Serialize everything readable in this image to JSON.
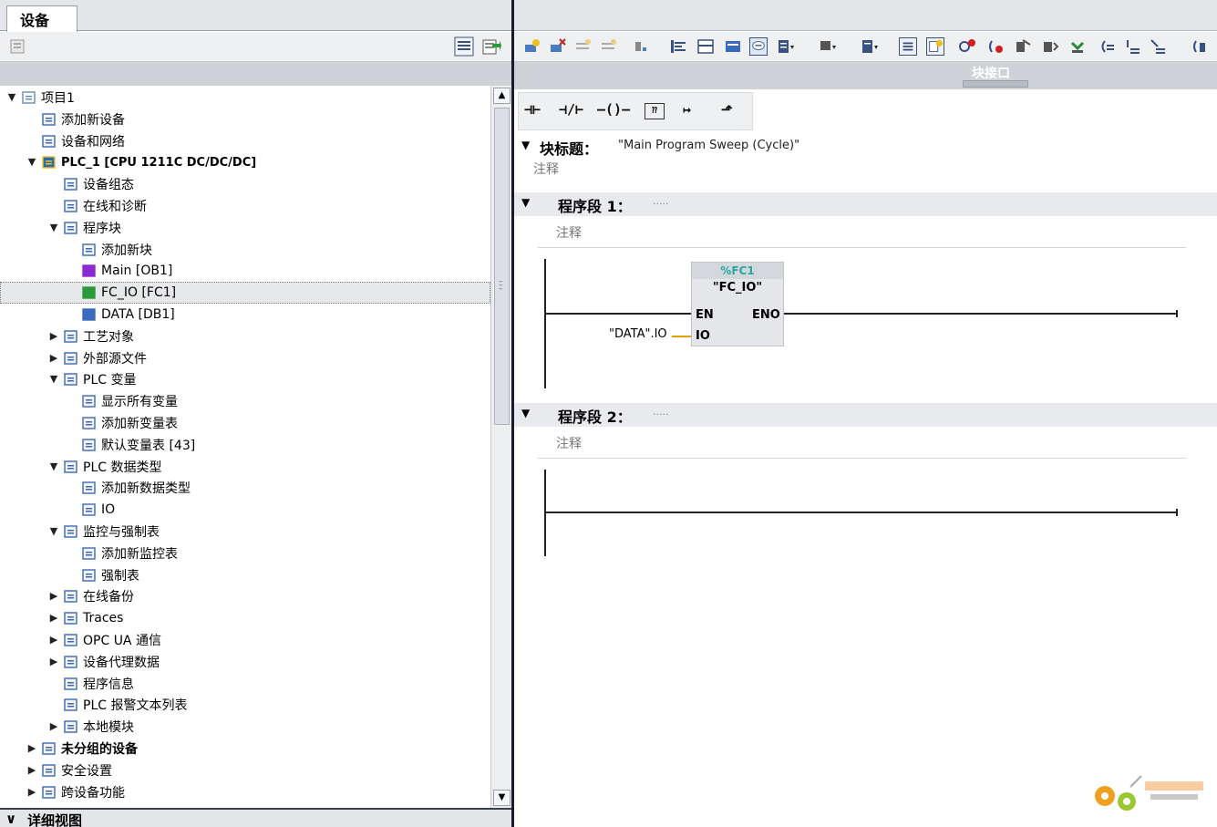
{
  "left_panel": {
    "tab": "设备",
    "tree": [
      {
        "label": "项目1",
        "arrow": "▼",
        "level": 0,
        "icon": "project-icon"
      },
      {
        "label": "添加新设备",
        "arrow": "",
        "level": 1,
        "icon": "add-device-icon"
      },
      {
        "label": "设备和网络",
        "arrow": "",
        "level": 1,
        "icon": "network-icon"
      },
      {
        "label": "PLC_1 [CPU 1211C DC/DC/DC]",
        "arrow": "▼",
        "level": 1,
        "icon": "plc-icon",
        "style": "plc"
      },
      {
        "label": "设备组态",
        "arrow": "",
        "level": 2,
        "icon": "device-config-icon"
      },
      {
        "label": "在线和诊断",
        "arrow": "",
        "level": 2,
        "icon": "online-diagnostics-icon"
      },
      {
        "label": "程序块",
        "arrow": "▼",
        "level": 2,
        "icon": "program-blocks-folder-icon"
      },
      {
        "label": "添加新块",
        "arrow": "",
        "level": 3,
        "icon": "add-block-icon"
      },
      {
        "label": "Main [OB1]",
        "arrow": "",
        "level": 3,
        "icon": "ob-block-icon"
      },
      {
        "label": "FC_IO [FC1]",
        "arrow": "",
        "level": 3,
        "icon": "fc-block-icon",
        "selected": true
      },
      {
        "label": "DATA [DB1]",
        "arrow": "",
        "level": 3,
        "icon": "db-block-icon"
      },
      {
        "label": "工艺对象",
        "arrow": "▶",
        "level": 2,
        "icon": "technology-objects-icon"
      },
      {
        "label": "外部源文件",
        "arrow": "▶",
        "level": 2,
        "icon": "external-source-icon"
      },
      {
        "label": "PLC 变量",
        "arrow": "▼",
        "level": 2,
        "icon": "plc-tags-folder-icon"
      },
      {
        "label": "显示所有变量",
        "arrow": "",
        "level": 3,
        "icon": "show-all-tags-icon"
      },
      {
        "label": "添加新变量表",
        "arrow": "",
        "level": 3,
        "icon": "add-tag-table-icon"
      },
      {
        "label": "默认变量表 [43]",
        "arrow": "",
        "level": 3,
        "icon": "default-tag-table-icon"
      },
      {
        "label": "PLC 数据类型",
        "arrow": "▼",
        "level": 2,
        "icon": "plc-datatypes-folder-icon"
      },
      {
        "label": "添加新数据类型",
        "arrow": "",
        "level": 3,
        "icon": "add-datatype-icon"
      },
      {
        "label": "IO",
        "arrow": "",
        "level": 3,
        "icon": "udt-icon"
      },
      {
        "label": "监控与强制表",
        "arrow": "▼",
        "level": 2,
        "icon": "watch-force-folder-icon"
      },
      {
        "label": "添加新监控表",
        "arrow": "",
        "level": 3,
        "icon": "add-watch-table-icon"
      },
      {
        "label": "强制表",
        "arrow": "",
        "level": 3,
        "icon": "force-table-icon"
      },
      {
        "label": "在线备份",
        "arrow": "▶",
        "level": 2,
        "icon": "online-backup-icon"
      },
      {
        "label": "Traces",
        "arrow": "▶",
        "level": 2,
        "icon": "traces-icon"
      },
      {
        "label": "OPC UA 通信",
        "arrow": "▶",
        "level": 2,
        "icon": "opc-ua-icon"
      },
      {
        "label": "设备代理数据",
        "arrow": "▶",
        "level": 2,
        "icon": "device-proxy-icon"
      },
      {
        "label": "程序信息",
        "arrow": "",
        "level": 2,
        "icon": "program-info-icon"
      },
      {
        "label": "PLC 报警文本列表",
        "arrow": "",
        "level": 2,
        "icon": "alarm-text-icon"
      },
      {
        "label": "本地模块",
        "arrow": "▶",
        "level": 2,
        "icon": "local-modules-icon"
      },
      {
        "label": "未分组的设备",
        "arrow": "▶",
        "level": 1,
        "icon": "ungrouped-devices-icon",
        "style": "bold"
      },
      {
        "label": "安全设置",
        "arrow": "▶",
        "level": 1,
        "icon": "security-settings-icon"
      },
      {
        "label": "跨设备功能",
        "arrow": "▶",
        "level": 1,
        "icon": "cross-device-icon"
      }
    ],
    "detail_view": {
      "arrow": "∨",
      "label": "详细视图"
    }
  },
  "editor": {
    "interface_title": "块接口",
    "block_title_label": "块标题：",
    "block_title_value": "\"Main Program Sweep (Cycle)\"",
    "block_comment": "注释",
    "networks": [
      {
        "title": "程序段 1：",
        "dots": ".....",
        "comment": "注释"
      },
      {
        "title": "程序段 2：",
        "dots": ".....",
        "comment": "注释"
      }
    ],
    "fc_call": {
      "address": "%FC1",
      "name": "\"FC_IO\"",
      "en": "EN",
      "eno": "ENO",
      "io_pin": "IO",
      "io_param": "\"DATA\".IO"
    },
    "lad_toolbar": [
      "⊣⊢",
      "⊣/⊢",
      "–()–",
      "⁇",
      "↦",
      "⬏"
    ]
  },
  "colors": {
    "fc_address": "#2aa7a0",
    "io_wire": "#e8a000",
    "selected_row": "#e6e8ea"
  }
}
